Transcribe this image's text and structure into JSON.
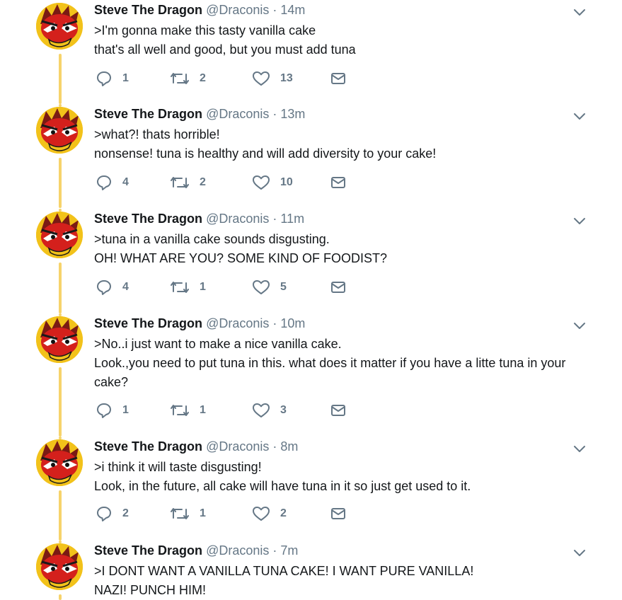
{
  "tweets": [
    {
      "name": "Steve The Dragon",
      "handle": "@Draconis",
      "sep": "·",
      "time": "14m",
      "lines": [
        ">I'm gonna make this tasty vanilla cake",
        "that's all well and good, but you must add tuna"
      ],
      "replies": "1",
      "retweets": "2",
      "likes": "13"
    },
    {
      "name": "Steve The Dragon",
      "handle": "@Draconis",
      "sep": "·",
      "time": "13m",
      "lines": [
        ">what?! thats horrible!",
        "nonsense! tuna is healthy and will add diversity to your cake!"
      ],
      "replies": "4",
      "retweets": "2",
      "likes": "10"
    },
    {
      "name": "Steve The Dragon",
      "handle": "@Draconis",
      "sep": "·",
      "time": "11m",
      "lines": [
        ">tuna in a vanilla cake sounds disgusting.",
        "OH! WHAT ARE YOU? SOME KIND OF FOODIST?"
      ],
      "replies": "4",
      "retweets": "1",
      "likes": "5"
    },
    {
      "name": "Steve The Dragon",
      "handle": "@Draconis",
      "sep": "·",
      "time": "10m",
      "lines": [
        ">No..i just want to make a nice vanilla cake.",
        "Look.,you need to put tuna in this. what does it matter if you have a litte tuna in your cake?"
      ],
      "replies": "1",
      "retweets": "1",
      "likes": "3"
    },
    {
      "name": "Steve The Dragon",
      "handle": "@Draconis",
      "sep": "·",
      "time": "8m",
      "lines": [
        ">i think it will taste disgusting!",
        "Look, in the future, all cake will have tuna in it so just get used to it."
      ],
      "replies": "2",
      "retweets": "1",
      "likes": "2"
    },
    {
      "name": "Steve The Dragon",
      "handle": "@Draconis",
      "sep": "·",
      "time": "7m",
      "lines": [
        ">I DONT WANT A VANILLA TUNA CAKE! I WANT PURE VANILLA!",
        "NAZI! PUNCH HIM!"
      ]
    }
  ],
  "icons": {
    "reply": "reply-icon",
    "retweet": "retweet-icon",
    "like": "heart-icon",
    "dm": "envelope-icon",
    "caret": "chevron-down-icon",
    "avatar": "dragon-avatar"
  },
  "colors": {
    "text": "#14171a",
    "muted": "#657786",
    "thread": "#f6d36b",
    "icon": "#657786"
  }
}
